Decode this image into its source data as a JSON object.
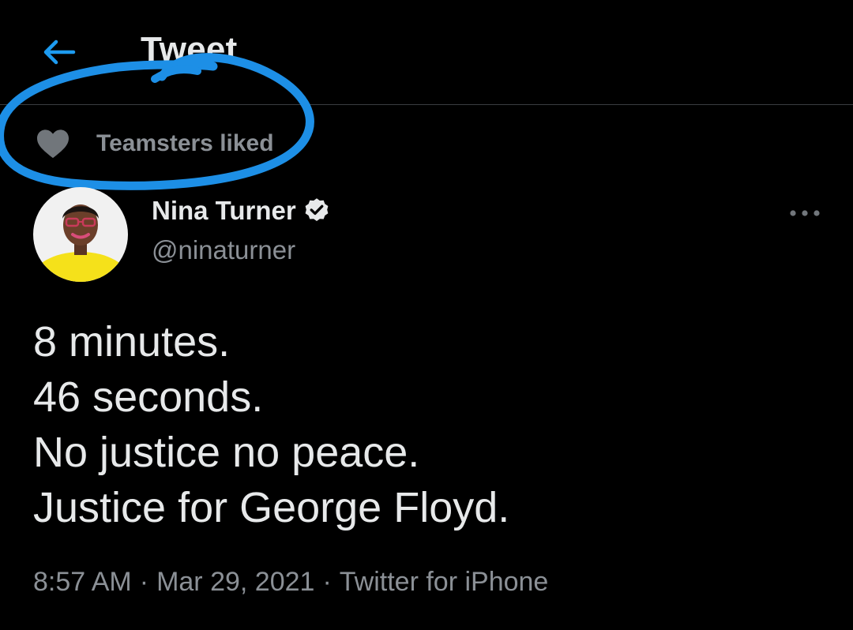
{
  "colors": {
    "background": "#000000",
    "accent": "#1d9bf0",
    "primary_text": "#e7e9ea",
    "secondary_text": "#8b9096",
    "divider": "#3a3d40",
    "scribble": "#1d8fe6"
  },
  "header": {
    "back_icon": "arrow-left-icon",
    "title": "Tweet"
  },
  "social_context": {
    "icon": "heart-icon",
    "text": "Teamsters liked"
  },
  "tweet": {
    "author": {
      "name": "Nina Turner",
      "handle": "@ninaturner",
      "verified_icon": "verified-badge-icon"
    },
    "more_icon": "more-dots-icon",
    "text_lines": [
      "8 minutes.",
      "46 seconds.",
      "No justice no peace.",
      "Justice for George Floyd."
    ],
    "time": "8:57 AM",
    "date": "Mar 29, 2021",
    "source": "Twitter for iPhone",
    "separator": "·"
  }
}
